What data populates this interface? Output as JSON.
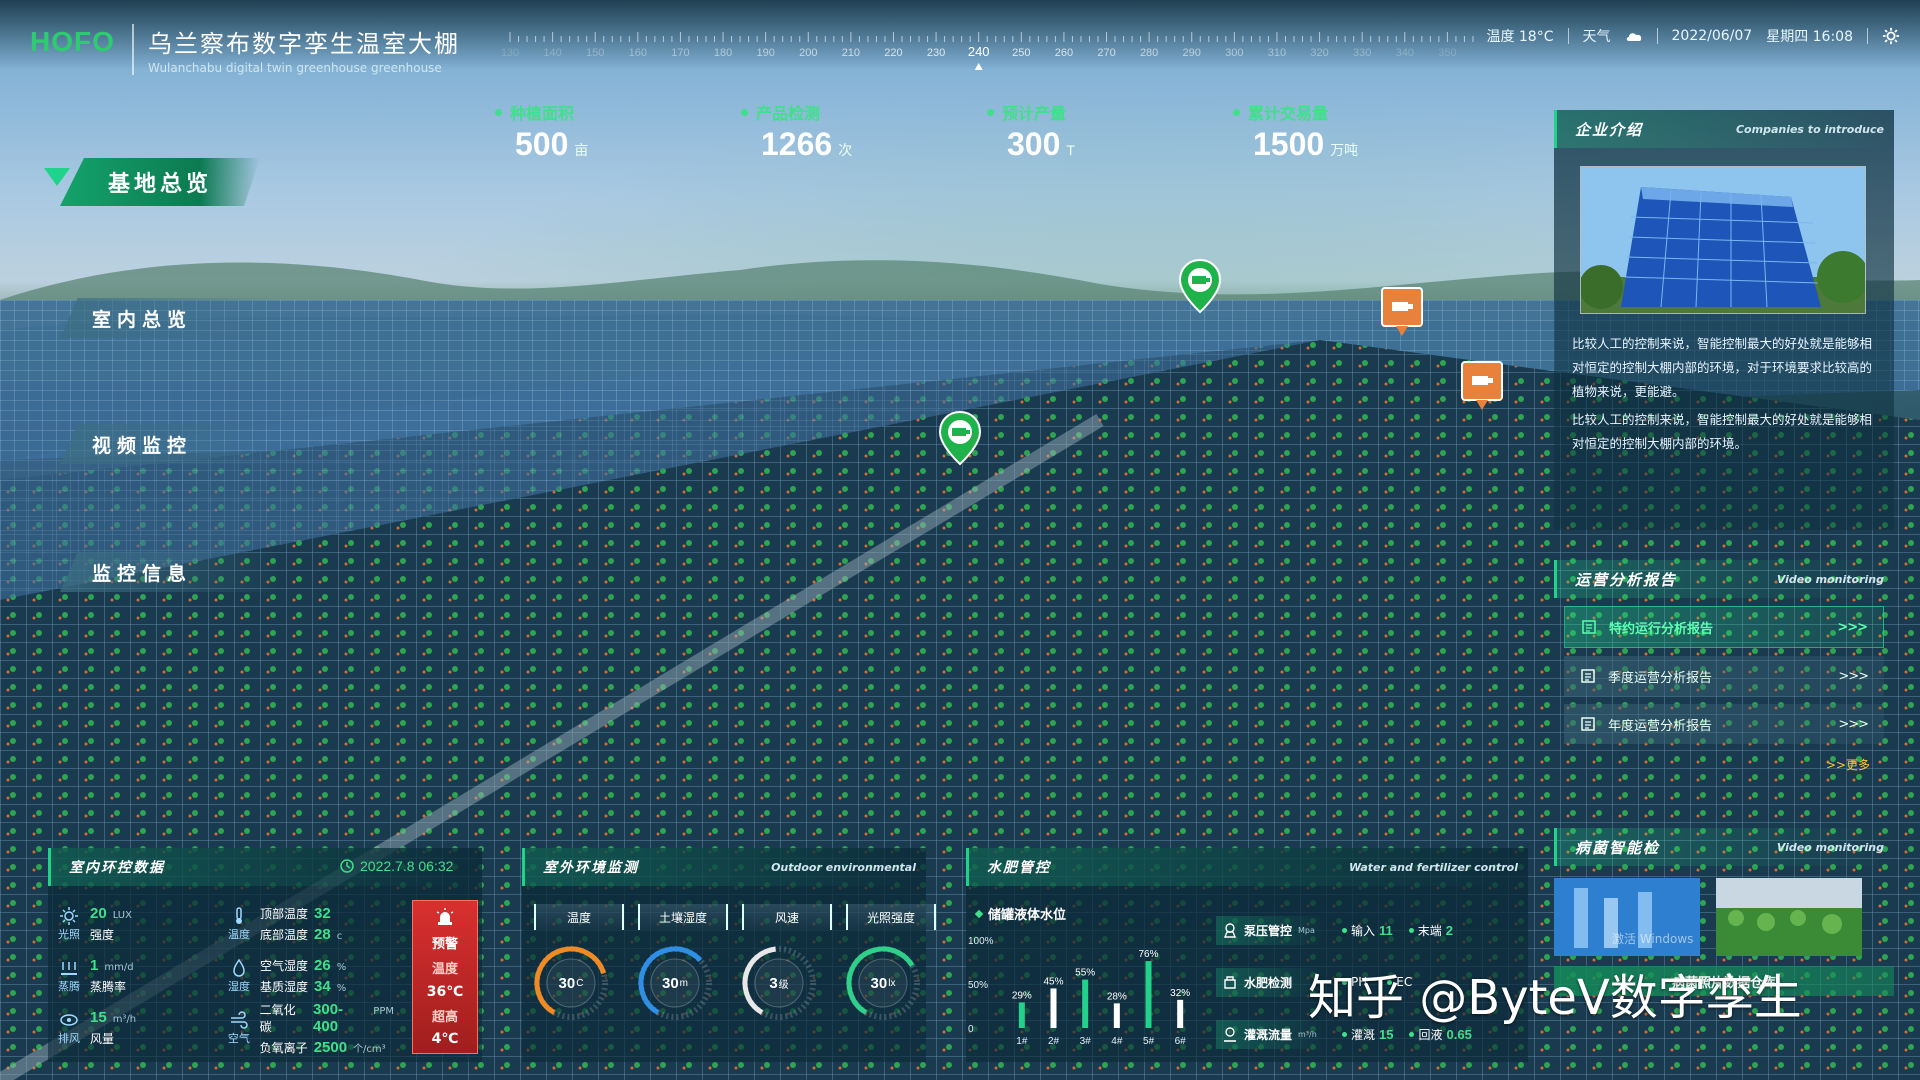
{
  "header": {
    "logo": "HOFO",
    "title_cn": "乌兰察布数字孪生温室大棚",
    "title_en": "Wulanchabu digital twin greenhouse greenhouse",
    "ruler_ticks": [
      "130",
      "140",
      "150",
      "160",
      "170",
      "180",
      "190",
      "200",
      "210",
      "220",
      "230",
      "240",
      "250",
      "260",
      "270",
      "280",
      "290",
      "300",
      "310",
      "320",
      "330",
      "340",
      "350"
    ],
    "ruler_center": "240",
    "temperature": "温度 18°C",
    "weather_label": "天气",
    "date": "2022/06/07",
    "weekday_time": "星期四 16:08"
  },
  "stats": [
    {
      "label": "种植面积",
      "value": "500",
      "unit": "亩"
    },
    {
      "label": "产品检测",
      "value": "1266",
      "unit": "次"
    },
    {
      "label": "预计产量",
      "value": "300",
      "unit": "T"
    },
    {
      "label": "累计交易量",
      "value": "1500",
      "unit": "万吨"
    }
  ],
  "nav": {
    "main": "基地总览",
    "items": [
      "室内总览",
      "视频监控",
      "监控信息"
    ]
  },
  "company": {
    "title_cn": "企业介绍",
    "title_en": "Companies to introduce",
    "para1": "比较人工的控制来说，智能控制最大的好处就是能够相对恒定的控制大棚内部的环境，对于环境要求比较高的植物来说，更能避。",
    "para2": "比较人工的控制来说，智能控制最大的好处就是能够相对恒定的控制大棚内部的环境。"
  },
  "operations": {
    "title_cn": "运营分析报告",
    "title_en": "Video monitoring",
    "reports": [
      "特约运行分析报告",
      "季度运营分析报告",
      "年度运营分析报告"
    ],
    "arrow": ">>>",
    "more": ">>更多"
  },
  "pest": {
    "title_cn": "病菌智能检",
    "title_en": "Video monitoring",
    "overlay": "激活 Windows",
    "button": "病菌照片数据仓库"
  },
  "indoor": {
    "title": "室内环控数据",
    "time": "2022.7.8 06:32",
    "rows": [
      [
        {
          "icon": "sun-icon",
          "icon_label": "光照",
          "lines": [
            {
              "num": "20",
              "unit": "LUX"
            },
            {
              "text": "强度"
            }
          ]
        },
        {
          "icon": "thermometer-icon",
          "icon_label": "温度",
          "lines": [
            {
              "text": "顶部温度",
              "num": "32",
              "unit": ""
            },
            {
              "text": "底部温度",
              "num": "28",
              "unit": "c"
            }
          ]
        }
      ],
      [
        {
          "icon": "evaporation-icon",
          "icon_label": "蒸腾",
          "lines": [
            {
              "num": "1",
              "unit": "mm/d"
            },
            {
              "text": "蒸腾率"
            }
          ]
        },
        {
          "icon": "humidity-icon",
          "icon_label": "湿度",
          "lines": [
            {
              "text": "空气湿度",
              "num": "26",
              "unit": "%"
            },
            {
              "text": "基质湿度",
              "num": "34",
              "unit": "%"
            }
          ]
        }
      ],
      [
        {
          "icon": "vent-icon",
          "icon_label": "排风",
          "lines": [
            {
              "num": "15",
              "unit": "m³/h"
            },
            {
              "text": "风量"
            }
          ]
        },
        {
          "icon": "air-icon",
          "icon_label": "空气",
          "lines": [
            {
              "text": "二氧化碳",
              "num": "300-400",
              "unit": "PPM"
            },
            {
              "text": "负氧离子",
              "num": "2500",
              "unit": "个/cm³"
            }
          ]
        }
      ]
    ],
    "alert": {
      "warn": "预警",
      "temp_label": "温度",
      "temp_value": "36℃",
      "high_label": "超高",
      "high_value": "4℃"
    }
  },
  "outdoor": {
    "title_cn": "室外环境监测",
    "title_en": "Outdoor environmental",
    "tabs": [
      "温度",
      "土壤湿度",
      "风速",
      "光照强度"
    ],
    "gauges": [
      {
        "value": "30",
        "unit": "C",
        "color": "#f08a24",
        "fraction": 0.62
      },
      {
        "value": "30",
        "unit": "m",
        "color": "#2f8fe6",
        "fraction": 0.55
      },
      {
        "value": "3",
        "unit": "级",
        "color": "#e8e8e8",
        "fraction": 0.4
      },
      {
        "value": "30",
        "unit": "lx",
        "color": "#2fd08a",
        "fraction": 0.58
      }
    ]
  },
  "fertilizer": {
    "title_cn": "水肥管控",
    "title_en": "Water and fertilizer control",
    "chart_title": "储罐液体水位",
    "chart_data": {
      "type": "bar",
      "title": "储罐液体水位",
      "categories": [
        "1#",
        "2#",
        "3#",
        "4#",
        "5#",
        "6#"
      ],
      "values": [
        29,
        45,
        55,
        28,
        76,
        32
      ],
      "value_labels": [
        "29%",
        "45%",
        "55%",
        "28%",
        "76%",
        "32%"
      ],
      "yticks": [
        "100%",
        "50%",
        "0"
      ],
      "ylim": [
        0,
        100
      ]
    },
    "controls": [
      {
        "icon": "pump-icon",
        "name": "泵压管控",
        "unit": "Mpa",
        "items": [
          {
            "k": "输入",
            "v": "11"
          },
          {
            "k": "末端",
            "v": "2"
          }
        ]
      },
      {
        "icon": "fertilizer-icon",
        "name": "水肥检测",
        "unit": "",
        "items": [
          {
            "k": "PH",
            "v": ""
          },
          {
            "k": "EC",
            "v": ""
          }
        ]
      },
      {
        "icon": "flow-icon",
        "name": "灌溉流量",
        "unit": "m³/h",
        "items": [
          {
            "k": "灌溉",
            "v": "15"
          },
          {
            "k": "回液",
            "v": "0.65"
          }
        ]
      }
    ]
  },
  "watermark": "知乎 @ByteV数字孪生"
}
